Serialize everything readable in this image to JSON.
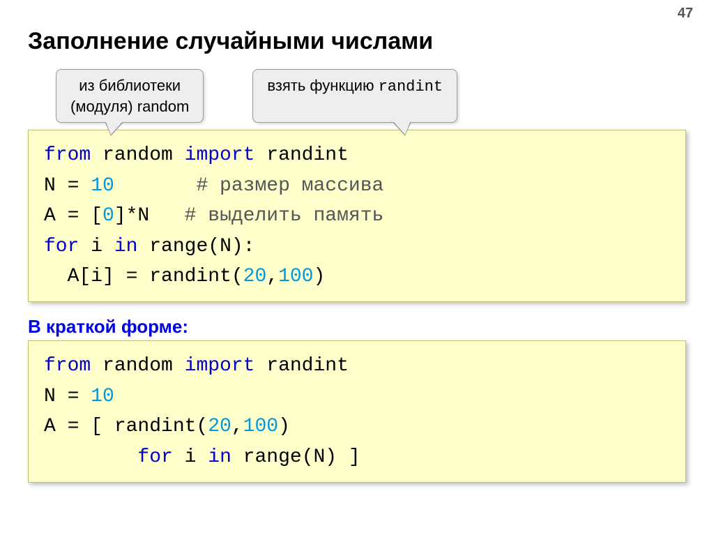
{
  "page_number": "47",
  "title": "Заполнение случайными числами",
  "callout1_line1": "из библиотеки",
  "callout1_line2": "(модуля) random",
  "callout2_prefix": "взять функцию ",
  "callout2_mono": "randint",
  "code1": {
    "l1_kw1": "from",
    "l1_t1": " random ",
    "l1_kw2": "import",
    "l1_t2": " randint",
    "l2_t1": "N = ",
    "l2_n1": "10",
    "l2_sp": "       ",
    "l2_c1": "# размер массива",
    "l3_t1": "A = [",
    "l3_n1": "0",
    "l3_t2": "]*N   ",
    "l3_c1": "# выделить память",
    "l4_kw1": "for",
    "l4_t1": " i ",
    "l4_kw2": "in",
    "l4_t2": " range(N):",
    "l5_t1": "  A[i] = randint(",
    "l5_n1": "20",
    "l5_t2": ",",
    "l5_n2": "100",
    "l5_t3": ")"
  },
  "subtitle": "В краткой форме:",
  "code2": {
    "l1_kw1": "from",
    "l1_t1": " random ",
    "l1_kw2": "import",
    "l1_t2": " randint",
    "l2_t1": "N = ",
    "l2_n1": "10",
    "l3_t1": "A = [ randint(",
    "l3_n1": "20",
    "l3_t2": ",",
    "l3_n2": "100",
    "l3_t3": ")",
    "l4_t1": "        ",
    "l4_kw1": "for",
    "l4_t2": " i ",
    "l4_kw2": "in",
    "l4_t3": " range(N) ]"
  }
}
